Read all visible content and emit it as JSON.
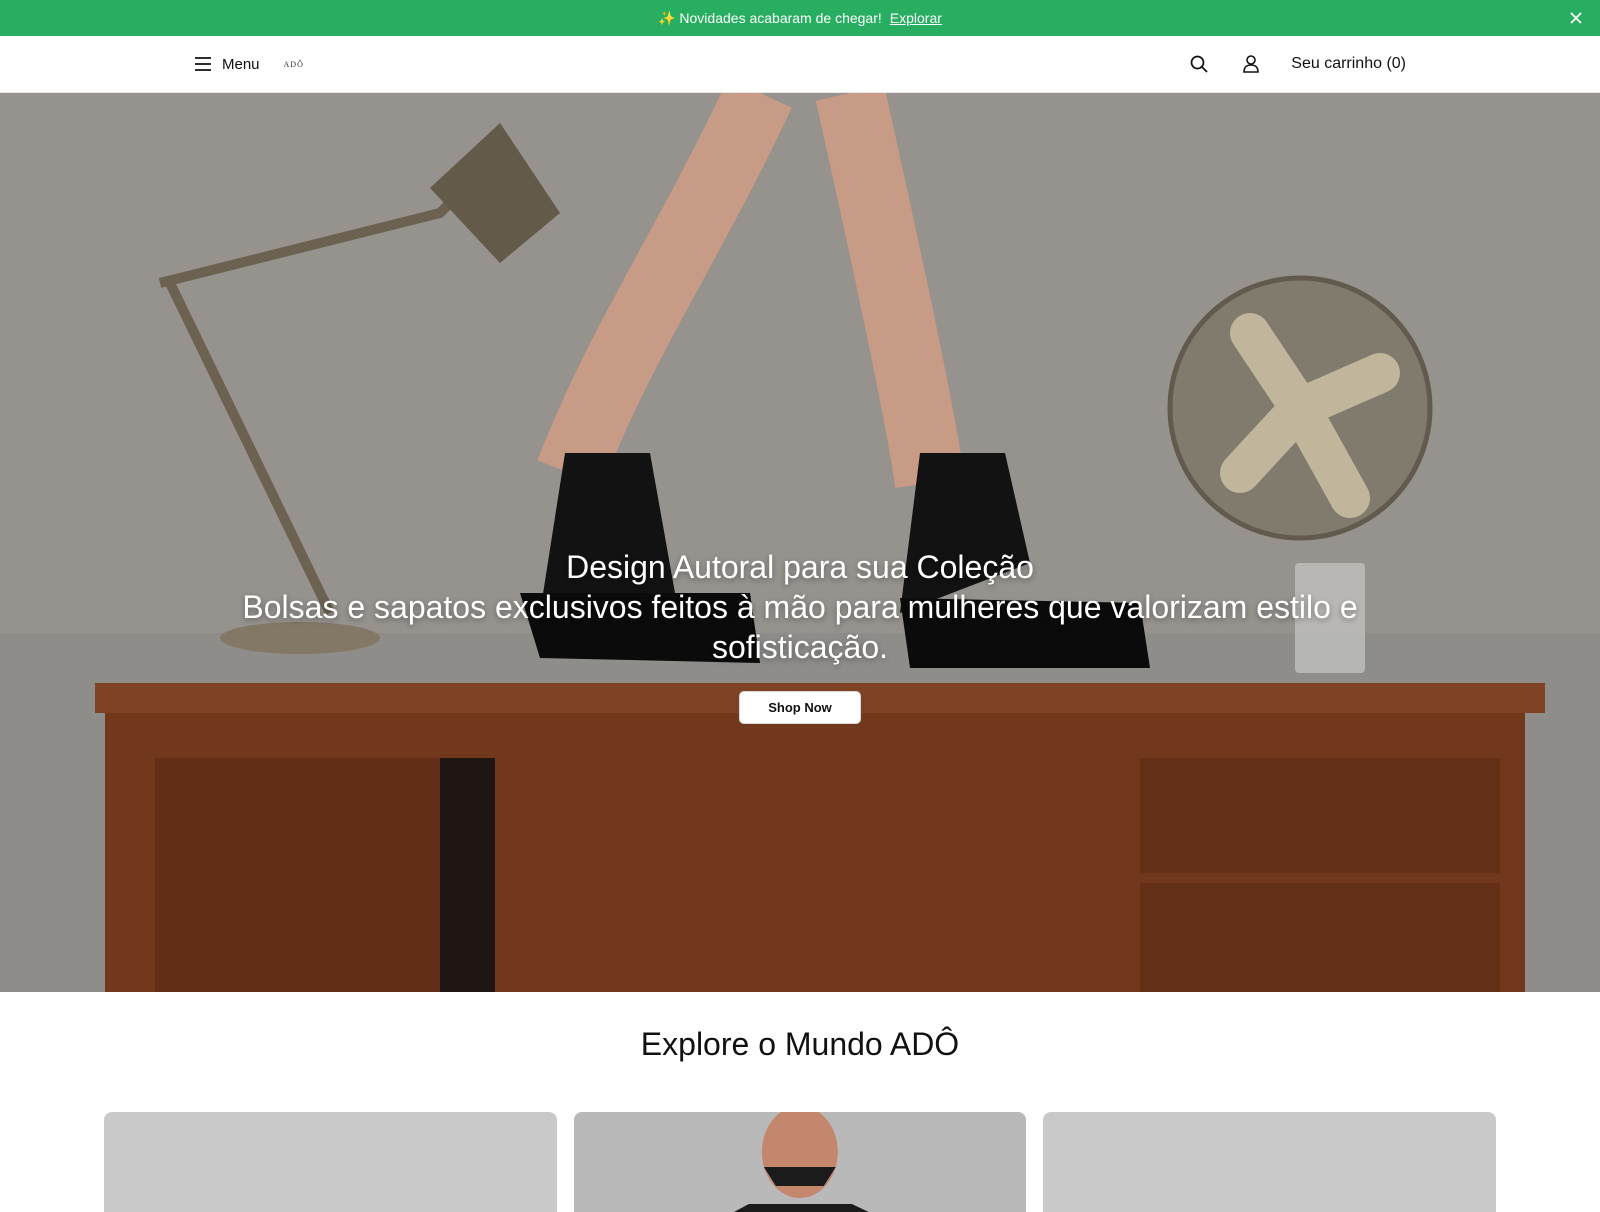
{
  "announcement": {
    "text": "✨ Novidades acabaram de chegar!",
    "link_label": "Explorar"
  },
  "header": {
    "menu_label": "Menu",
    "logo": "ADÔ",
    "cart_label": "Seu carrinho (0)"
  },
  "hero": {
    "title": "Design Autoral para sua Coleção",
    "subtitle": "Bolsas e sapatos exclusivos feitos à mão para mulheres que valorizam estilo e sofisticação.",
    "cta_label": "Shop Now"
  },
  "section": {
    "title": "Explore o Mundo ADÔ"
  },
  "colors": {
    "announcement_bg": "#27ae60",
    "hero_wall": "#8f8d8a",
    "desk": "#7a3f1f"
  },
  "icons": [
    "menu-icon",
    "close-icon",
    "search-icon",
    "user-icon"
  ]
}
